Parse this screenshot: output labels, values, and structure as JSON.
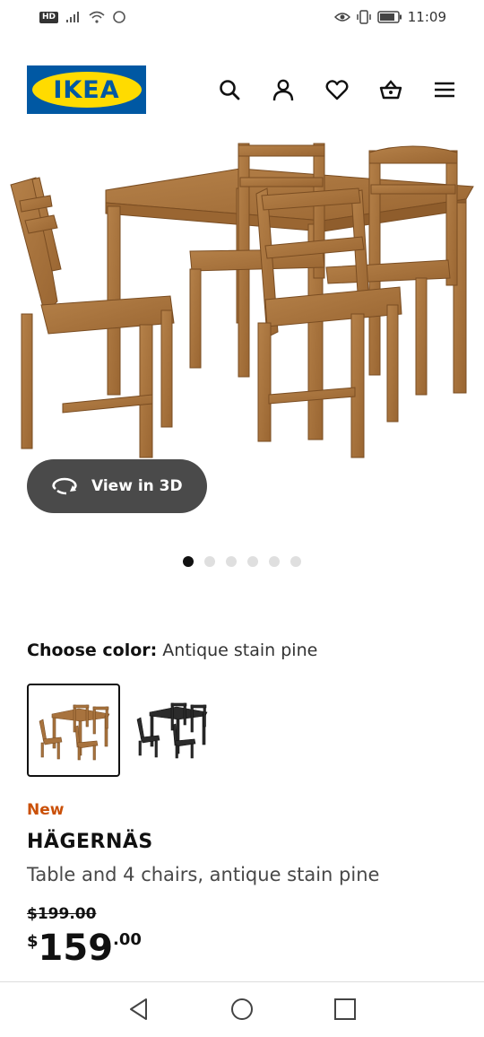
{
  "status_bar": {
    "hd_label": "HD",
    "time": "11:09"
  },
  "header": {
    "logo_text": "IKEA",
    "icons": [
      "search-icon",
      "account-icon",
      "heart-icon",
      "basket-icon",
      "menu-icon"
    ]
  },
  "gallery": {
    "view_3d_label": "View in 3D",
    "image_count": 6,
    "active_index": 0
  },
  "color": {
    "label": "Choose color:",
    "selected": "Antique stain pine",
    "options": [
      "antique-stain-pine",
      "black"
    ]
  },
  "product": {
    "badge": "New",
    "name": "HÄGERNÄS",
    "description": "Table and 4 chairs, antique stain pine",
    "old_price": "$199.00",
    "price_currency": "$",
    "price_integer": "159",
    "price_decimal": ".00"
  },
  "colors": {
    "ikea_blue": "#0058a3",
    "ikea_yellow": "#ffdb00",
    "new_orange": "#ca5008",
    "wood": "#a8733e"
  }
}
